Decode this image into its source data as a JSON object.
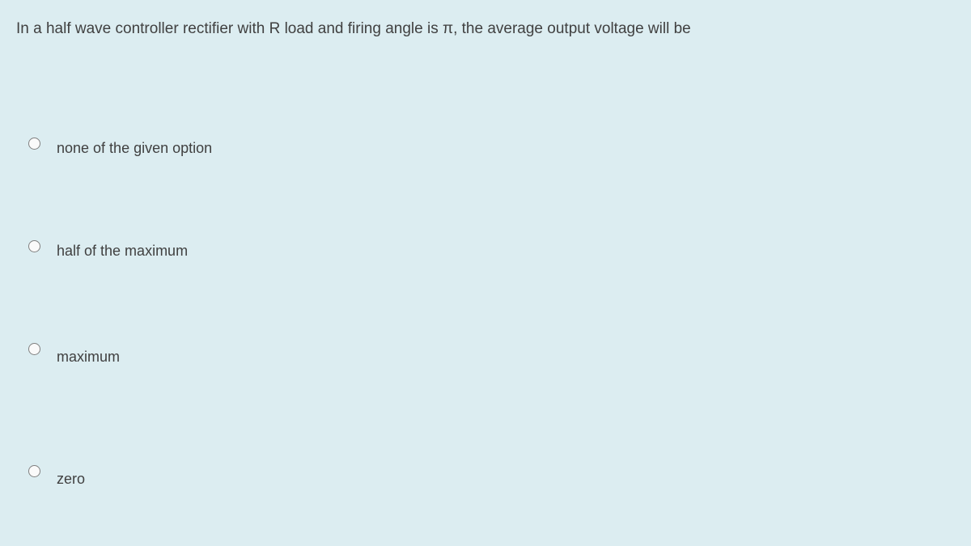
{
  "question": {
    "text": "In a half wave controller rectifier with R load and firing angle is π, the average output voltage will be"
  },
  "options": [
    {
      "label": "none of the given option"
    },
    {
      "label": "half of the maximum"
    },
    {
      "label": "maximum"
    },
    {
      "label": "zero"
    }
  ]
}
